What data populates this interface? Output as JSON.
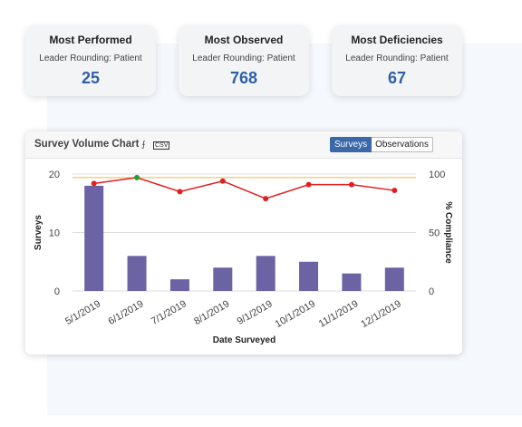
{
  "cards": [
    {
      "title": "Most Performed",
      "subtitle": "Leader Rounding: Patient",
      "value": "25"
    },
    {
      "title": "Most Observed",
      "subtitle": "Leader Rounding: Patient",
      "value": "768"
    },
    {
      "title": "Most Deficiencies",
      "subtitle": "Leader Rounding: Patient",
      "value": "67"
    }
  ],
  "chart_header": {
    "title": "Survey Volume Chart",
    "pdf_icon": "pdf-icon",
    "csv_icon": "csv-icon",
    "toggle_surveys": "Surveys",
    "toggle_observations": "Observations"
  },
  "colors": {
    "accent": "#2f5fa7",
    "bar": "#6b63a4",
    "line": "#e21f1f",
    "threshold": "#f0b64a"
  },
  "chart_data": {
    "type": "bar",
    "categories": [
      "5/1/2019",
      "6/1/2019",
      "7/1/2019",
      "8/1/2019",
      "9/1/2019",
      "10/1/2019",
      "11/1/2019",
      "12/1/2019"
    ],
    "series": [
      {
        "values": [
          18,
          6,
          2,
          4,
          6,
          5,
          3,
          4
        ]
      },
      {
        "values": [
          92,
          97,
          85,
          94,
          79,
          91,
          91,
          86
        ]
      }
    ],
    "xlabel": "Date Surveyed",
    "ylabel": "Surveys",
    "y2label": "% Compliance",
    "ylim": [
      0,
      20
    ],
    "y2lim": [
      0,
      100
    ],
    "yticks": [
      "0",
      "10",
      "20"
    ],
    "y2ticks": [
      "0",
      "50",
      "100"
    ],
    "threshold": 97
  }
}
